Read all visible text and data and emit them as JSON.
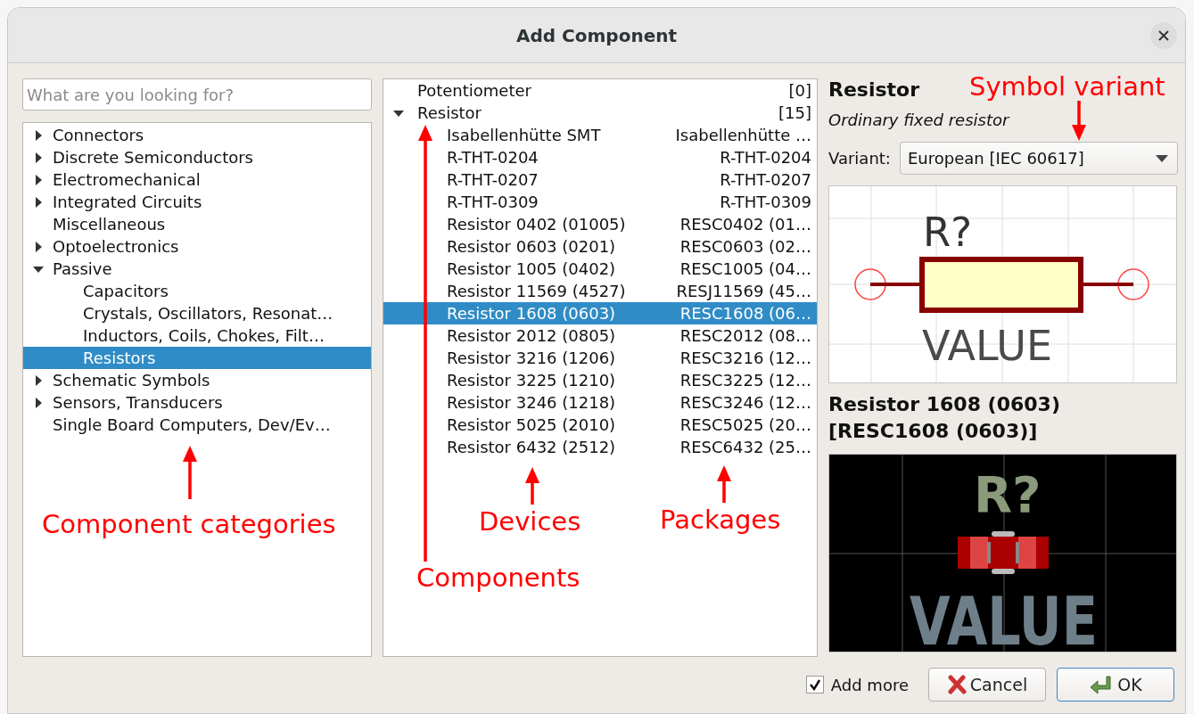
{
  "window": {
    "title": "Add Component"
  },
  "search": {
    "placeholder": "What are you looking for?"
  },
  "categories": [
    {
      "label": "Connectors",
      "kind": "folder",
      "expanded": false,
      "selected": false
    },
    {
      "label": "Discrete Semiconductors",
      "kind": "folder",
      "expanded": false,
      "selected": false
    },
    {
      "label": "Electromechanical",
      "kind": "folder",
      "expanded": false,
      "selected": false
    },
    {
      "label": "Integrated Circuits",
      "kind": "folder",
      "expanded": false,
      "selected": false
    },
    {
      "label": "Miscellaneous",
      "kind": "leaf",
      "selected": false
    },
    {
      "label": "Optoelectronics",
      "kind": "folder",
      "expanded": false,
      "selected": false
    },
    {
      "label": "Passive",
      "kind": "folder",
      "expanded": true,
      "selected": false,
      "children": [
        {
          "label": "Capacitors",
          "selected": false
        },
        {
          "label": "Crystals, Oscillators, Resonat…",
          "selected": false
        },
        {
          "label": "Inductors, Coils, Chokes, Filt…",
          "selected": false
        },
        {
          "label": "Resistors",
          "selected": true
        }
      ]
    },
    {
      "label": "Schematic Symbols",
      "kind": "folder",
      "expanded": false,
      "selected": false
    },
    {
      "label": "Sensors, Transducers",
      "kind": "folder",
      "expanded": false,
      "selected": false
    },
    {
      "label": "Single Board Computers, Dev/Ev…",
      "kind": "leaf",
      "selected": false
    }
  ],
  "components": [
    {
      "name": "Potentiometer",
      "count": "[0]",
      "kind": "leaf"
    },
    {
      "name": "Resistor",
      "count": "[15]",
      "kind": "folder",
      "expanded": true,
      "devices": [
        {
          "device": "Isabellenhütte SMT",
          "package": "Isabellenhütte …",
          "selected": false
        },
        {
          "device": "R-THT-0204",
          "package": "R-THT-0204",
          "selected": false
        },
        {
          "device": "R-THT-0207",
          "package": "R-THT-0207",
          "selected": false
        },
        {
          "device": "R-THT-0309",
          "package": "R-THT-0309",
          "selected": false
        },
        {
          "device": "Resistor 0402 (01005)",
          "package": "RESC0402 (01…",
          "selected": false
        },
        {
          "device": "Resistor 0603 (0201)",
          "package": "RESC0603 (02…",
          "selected": false
        },
        {
          "device": "Resistor 1005 (0402)",
          "package": "RESC1005 (04…",
          "selected": false
        },
        {
          "device": "Resistor 11569 (4527)",
          "package": "RESJ11569 (45…",
          "selected": false
        },
        {
          "device": "Resistor 1608 (0603)",
          "package": "RESC1608 (06…",
          "selected": true
        },
        {
          "device": "Resistor 2012 (0805)",
          "package": "RESC2012 (08…",
          "selected": false
        },
        {
          "device": "Resistor 3216 (1206)",
          "package": "RESC3216 (12…",
          "selected": false
        },
        {
          "device": "Resistor 3225 (1210)",
          "package": "RESC3225 (12…",
          "selected": false
        },
        {
          "device": "Resistor 3246 (1218)",
          "package": "RESC3246 (12…",
          "selected": false
        },
        {
          "device": "Resistor 5025 (2010)",
          "package": "RESC5025 (20…",
          "selected": false
        },
        {
          "device": "Resistor 6432 (2512)",
          "package": "RESC6432 (25…",
          "selected": false
        }
      ]
    }
  ],
  "details": {
    "title": "Resistor",
    "description": "Ordinary fixed resistor",
    "variant_label": "Variant:",
    "variant": "European [IEC 60617]",
    "symbol": {
      "reference": "R?",
      "value": "VALUE"
    },
    "footprint_title": [
      "Resistor 1608 (0603)",
      "[RESC1608 (0603)]"
    ],
    "footprint": {
      "reference": "R?",
      "value": "VALUE"
    }
  },
  "footer": {
    "add_more": {
      "label": "Add more",
      "checked": true
    },
    "cancel": "Cancel",
    "ok": "OK"
  },
  "annotations": [
    {
      "text": "Symbol variant"
    },
    {
      "text": "Component categories"
    },
    {
      "text": "Devices"
    },
    {
      "text": "Packages"
    },
    {
      "text": "Components"
    }
  ]
}
